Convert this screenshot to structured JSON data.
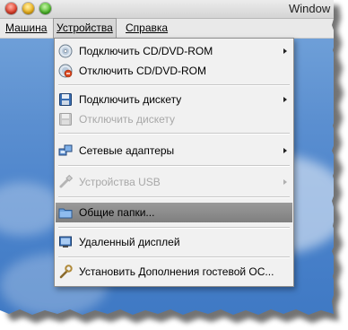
{
  "window": {
    "title": "Window"
  },
  "menubar": {
    "items": [
      {
        "label": "Машина"
      },
      {
        "label": "Устройства"
      },
      {
        "label": "Справка"
      }
    ]
  },
  "dropdown": {
    "items": [
      {
        "label": "Подключить CD/DVD-ROM",
        "icon": "cd-icon",
        "submenu": true,
        "enabled": true
      },
      {
        "label": "Отключить CD/DVD-ROM",
        "icon": "cd-eject-icon",
        "submenu": false,
        "enabled": true
      },
      {
        "label": "Подключить дискету",
        "icon": "floppy-icon",
        "submenu": true,
        "enabled": true
      },
      {
        "label": "Отключить дискету",
        "icon": "floppy-eject-icon",
        "submenu": false,
        "enabled": false
      },
      {
        "label": "Сетевые адаптеры",
        "icon": "network-icon",
        "submenu": true,
        "enabled": true
      },
      {
        "label": "Устройства USB",
        "icon": "usb-icon",
        "submenu": true,
        "enabled": false
      },
      {
        "label": "Общие папки...",
        "icon": "folder-icon",
        "submenu": false,
        "enabled": true,
        "highlighted": true
      },
      {
        "label": "Удаленный дисплей",
        "icon": "remote-display-icon",
        "submenu": false,
        "enabled": true
      },
      {
        "label": "Установить Дополнения гостевой ОС...",
        "icon": "wrench-icon",
        "submenu": false,
        "enabled": true
      }
    ]
  }
}
